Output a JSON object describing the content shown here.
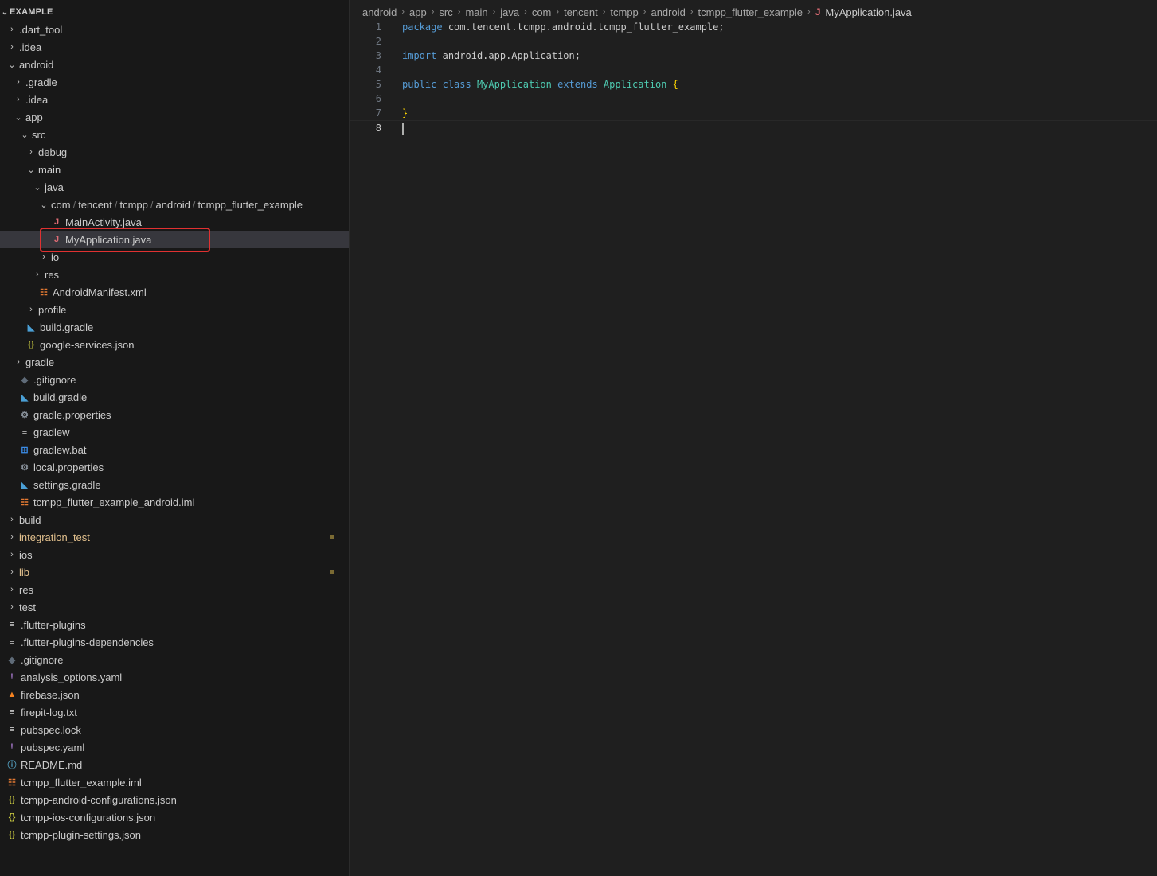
{
  "explorer": {
    "title": "EXAMPLE",
    "tree": [
      {
        "label": ".dart_tool",
        "depth": 0,
        "twisty": "collapsed"
      },
      {
        "label": ".idea",
        "depth": 0,
        "twisty": "collapsed"
      },
      {
        "label": "android",
        "depth": 0,
        "twisty": "expanded"
      },
      {
        "label": ".gradle",
        "depth": 1,
        "twisty": "collapsed"
      },
      {
        "label": ".idea",
        "depth": 1,
        "twisty": "collapsed"
      },
      {
        "label": "app",
        "depth": 1,
        "twisty": "expanded"
      },
      {
        "label": "src",
        "depth": 2,
        "twisty": "expanded"
      },
      {
        "label": "debug",
        "depth": 3,
        "twisty": "collapsed"
      },
      {
        "label": "main",
        "depth": 3,
        "twisty": "expanded"
      },
      {
        "label": "java",
        "depth": 4,
        "twisty": "expanded"
      },
      {
        "segments": [
          "com",
          "tencent",
          "tcmpp",
          "android",
          "tcmpp_flutter_example"
        ],
        "depth": 5,
        "twisty": "expanded"
      },
      {
        "label": "MainActivity.java",
        "depth": 6,
        "icon": "java-icon"
      },
      {
        "label": "MyApplication.java",
        "depth": 6,
        "icon": "java-icon",
        "selected": true
      },
      {
        "label": "io",
        "depth": 5,
        "twisty": "collapsed"
      },
      {
        "label": "res",
        "depth": 4,
        "twisty": "collapsed"
      },
      {
        "label": "AndroidManifest.xml",
        "depth": 4,
        "icon": "rss-icon"
      },
      {
        "label": "profile",
        "depth": 3,
        "twisty": "collapsed"
      },
      {
        "label": "build.gradle",
        "depth": 2,
        "icon": "elephant-icon"
      },
      {
        "label": "google-services.json",
        "depth": 2,
        "icon": "json-icon"
      },
      {
        "label": "gradle",
        "depth": 1,
        "twisty": "collapsed"
      },
      {
        "label": ".gitignore",
        "depth": 1,
        "icon": "git-icon"
      },
      {
        "label": "build.gradle",
        "depth": 1,
        "icon": "elephant-icon"
      },
      {
        "label": "gradle.properties",
        "depth": 1,
        "icon": "gear-icon"
      },
      {
        "label": "gradlew",
        "depth": 1,
        "icon": "lines-icon"
      },
      {
        "label": "gradlew.bat",
        "depth": 1,
        "icon": "windows-icon"
      },
      {
        "label": "local.properties",
        "depth": 1,
        "icon": "gear-icon"
      },
      {
        "label": "settings.gradle",
        "depth": 1,
        "icon": "elephant-icon"
      },
      {
        "label": "tcmpp_flutter_example_android.iml",
        "depth": 1,
        "icon": "rss-icon"
      },
      {
        "label": "build",
        "depth": 0,
        "twisty": "collapsed"
      },
      {
        "label": "integration_test",
        "depth": 0,
        "twisty": "collapsed",
        "modified": true
      },
      {
        "label": "ios",
        "depth": 0,
        "twisty": "collapsed"
      },
      {
        "label": "lib",
        "depth": 0,
        "twisty": "collapsed",
        "modified": true
      },
      {
        "label": "res",
        "depth": 0,
        "twisty": "collapsed"
      },
      {
        "label": "test",
        "depth": 0,
        "twisty": "collapsed"
      },
      {
        "label": ".flutter-plugins",
        "depth": 0,
        "icon": "lines-icon"
      },
      {
        "label": ".flutter-plugins-dependencies",
        "depth": 0,
        "icon": "lines-icon"
      },
      {
        "label": ".gitignore",
        "depth": 0,
        "icon": "git-icon"
      },
      {
        "label": "analysis_options.yaml",
        "depth": 0,
        "icon": "exclamation-icon"
      },
      {
        "label": "firebase.json",
        "depth": 0,
        "icon": "firebase-icon"
      },
      {
        "label": "firepit-log.txt",
        "depth": 0,
        "icon": "lines-icon"
      },
      {
        "label": "pubspec.lock",
        "depth": 0,
        "icon": "lines-icon"
      },
      {
        "label": "pubspec.yaml",
        "depth": 0,
        "icon": "exclamation-icon"
      },
      {
        "label": "README.md",
        "depth": 0,
        "icon": "info-icon"
      },
      {
        "label": "tcmpp_flutter_example.iml",
        "depth": 0,
        "icon": "rss-icon"
      },
      {
        "label": "tcmpp-android-configurations.json",
        "depth": 0,
        "icon": "json-icon"
      },
      {
        "label": "tcmpp-ios-configurations.json",
        "depth": 0,
        "icon": "json-icon"
      },
      {
        "label": "tcmpp-plugin-settings.json",
        "depth": 0,
        "icon": "json-icon"
      }
    ]
  },
  "breadcrumb": [
    "android",
    "app",
    "src",
    "main",
    "java",
    "com",
    "tencent",
    "tcmpp",
    "android",
    "tcmpp_flutter_example"
  ],
  "breadcrumb_file": "MyApplication.java",
  "editor": {
    "active_line": 8,
    "lines": [
      {
        "n": "1",
        "tokens": [
          [
            "kw",
            "package"
          ],
          [
            "",
            ""
          ],
          [
            "",
            "com.tencent.tcmpp.android.tcmpp_flutter_example;"
          ]
        ]
      },
      {
        "n": "2",
        "tokens": []
      },
      {
        "n": "3",
        "tokens": [
          [
            "kw",
            "import"
          ],
          [
            "",
            "android.app.Application;"
          ]
        ]
      },
      {
        "n": "4",
        "tokens": []
      },
      {
        "n": "5",
        "tokens": [
          [
            "kw",
            "public"
          ],
          [
            "kw",
            "class"
          ],
          [
            "ty",
            "MyApplication"
          ],
          [
            "kw",
            "extends"
          ],
          [
            "ty",
            "Application"
          ],
          [
            "br",
            "{"
          ]
        ]
      },
      {
        "n": "6",
        "tokens": []
      },
      {
        "n": "7",
        "tokens": [
          [
            "br",
            "}"
          ]
        ]
      },
      {
        "n": "8",
        "tokens": [],
        "cursor": true
      }
    ]
  },
  "colors": {
    "sidebar_bg": "#181818",
    "editor_bg": "#1f1f1f",
    "selection": "#37373d",
    "highlight_box": "#e03131",
    "modified": "#e2c08d",
    "keyword": "#569cd6",
    "type": "#4ec9b0",
    "bracket": "#ffd700"
  }
}
